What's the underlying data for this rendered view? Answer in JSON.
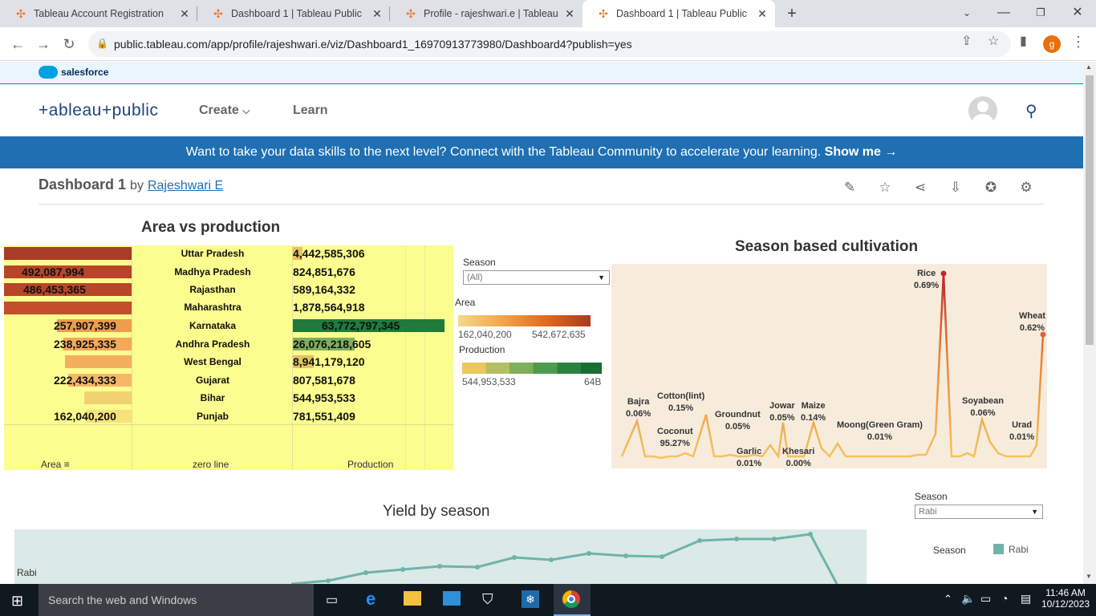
{
  "browser": {
    "tabs": [
      {
        "title": "Tableau Account Registration"
      },
      {
        "title": "Dashboard 1 | Tableau Public"
      },
      {
        "title": "Profile - rajeshwari.e | Tableau Pu"
      },
      {
        "title": "Dashboard 1 | Tableau Public"
      }
    ],
    "url": "public.tableau.com/app/profile/rajeshwari.e/viz/Dashboard1_16970913773980/Dashboard4?publish=yes",
    "profile_initial": "g"
  },
  "site": {
    "salesforce_label": "salesforce",
    "logo_text": "+ableau+public",
    "nav_create": "Create",
    "nav_learn": "Learn",
    "banner_text": "Want to take your data skills to the next level? Connect with the Tableau Community to accelerate your learning. ",
    "banner_link": "Show me →"
  },
  "viz_header": {
    "title": "Dashboard 1",
    "by": "by",
    "author": "Rajeshwari E"
  },
  "area_vs_production": {
    "title": "Area vs production",
    "rows": [
      {
        "state": "Uttar Pradesh",
        "area_label": "",
        "production": "4,442,585,306"
      },
      {
        "state": "Madhya Pradesh",
        "area_label": "492,087,994",
        "production": "824,851,676"
      },
      {
        "state": "Rajasthan",
        "area_label": "486,453,365",
        "production": "589,164,332"
      },
      {
        "state": "Maharashtra",
        "area_label": "",
        "production": "1,878,564,918"
      },
      {
        "state": "Karnataka",
        "area_label": "257,907,399",
        "production": "63,772,797,345"
      },
      {
        "state": "Andhra Pradesh",
        "area_label": "238,925,335",
        "production": "26,076,218,605"
      },
      {
        "state": "West Bengal",
        "area_label": "",
        "production": "8,941,179,120"
      },
      {
        "state": "Gujarat",
        "area_label": "222,434,333",
        "production": "807,581,678"
      },
      {
        "state": "Bihar",
        "area_label": "",
        "production": "544,953,533"
      },
      {
        "state": "Punjab",
        "area_label": "162,040,200",
        "production": "781,551,409"
      }
    ],
    "axis_area": "Area",
    "axis_zero": "zero line",
    "axis_production": "Production"
  },
  "filters": {
    "season_label": "Season",
    "season_value": "(All)",
    "area_label": "Area",
    "area_min": "162,040,200",
    "area_max": "542,672,635",
    "production_label": "Production",
    "production_min": "544,953,533",
    "production_max": "64B"
  },
  "season_cultivation": {
    "title": "Season based cultivation",
    "annotations": [
      {
        "crop": "Bajra",
        "pct": "0.06%"
      },
      {
        "crop": "Cotton(lint)",
        "pct": "0.15%"
      },
      {
        "crop": "Coconut",
        "pct": "95.27%"
      },
      {
        "crop": "Groundnut",
        "pct": "0.05%"
      },
      {
        "crop": "Garlic",
        "pct": "0.01%"
      },
      {
        "crop": "Jowar",
        "pct": "0.05%"
      },
      {
        "crop": "Maize",
        "pct": "0.14%"
      },
      {
        "crop": "Khesari",
        "pct": "0.00%"
      },
      {
        "crop": "Moong(Green Gram)",
        "pct": "0.01%"
      },
      {
        "crop": "Rice",
        "pct": "0.69%"
      },
      {
        "crop": "Soyabean",
        "pct": "0.06%"
      },
      {
        "crop": "Wheat",
        "pct": "0.62%"
      },
      {
        "crop": "Urad",
        "pct": "0.01%"
      }
    ]
  },
  "yield_by_season": {
    "title": "Yield by season",
    "season_filter_label": "Season",
    "season_filter_value": "Rabi",
    "legend_title": "Season",
    "legend_item": "Rabi",
    "row_label": "Rabi",
    "colors": {
      "line": "#6fb3ab",
      "area_bg": "#dbeae6"
    }
  },
  "taskbar": {
    "search_placeholder": "Search the web and Windows",
    "time": "11:46 AM",
    "date": "10/12/2023"
  }
}
